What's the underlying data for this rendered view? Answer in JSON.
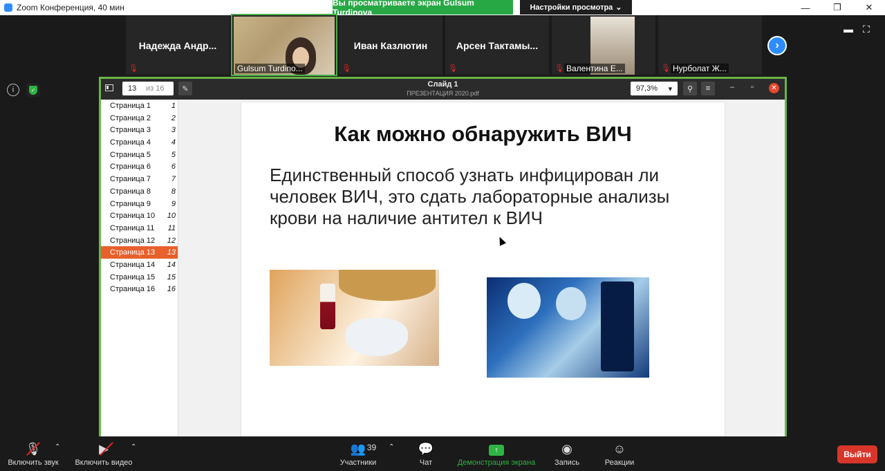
{
  "window": {
    "title": "Zoom Конференция, 40 мин",
    "share_banner": "Вы просматриваете экран Gulsum Turdinova",
    "view_settings": "Настройки просмотра",
    "controls": [
      "—",
      "❐",
      "✕"
    ]
  },
  "participants": [
    {
      "name": "Надежда  Андр...",
      "muted": true,
      "video": false
    },
    {
      "name": "Gulsum Turdino...",
      "muted": false,
      "video": true,
      "active": true
    },
    {
      "name": "Иван Казлютин",
      "muted": true,
      "video": false
    },
    {
      "name": "Арсен  Тактамы...",
      "muted": true,
      "video": false
    },
    {
      "name": "Валентина Е...",
      "muted": true,
      "video": true
    },
    {
      "name": "Нурболат Ж...",
      "muted": true,
      "video": false
    }
  ],
  "viewer": {
    "page_current": "13",
    "page_of": "из 16",
    "doc_title": "Слайд 1",
    "doc_subtitle": "ПРЕЗЕНТАЦИЯ 2020.pdf",
    "zoom": "97,3%"
  },
  "pages": [
    {
      "label": "Страница 1",
      "num": "1"
    },
    {
      "label": "Страница 2",
      "num": "2"
    },
    {
      "label": "Страница 3",
      "num": "3"
    },
    {
      "label": "Страница 4",
      "num": "4"
    },
    {
      "label": "Страница 5",
      "num": "5"
    },
    {
      "label": "Страница 6",
      "num": "6"
    },
    {
      "label": "Страница 7",
      "num": "7"
    },
    {
      "label": "Страница 8",
      "num": "8"
    },
    {
      "label": "Страница 9",
      "num": "9"
    },
    {
      "label": "Страница 10",
      "num": "10"
    },
    {
      "label": "Страница 11",
      "num": "11"
    },
    {
      "label": "Страница 12",
      "num": "12"
    },
    {
      "label": "Страница 13",
      "num": "13",
      "selected": true
    },
    {
      "label": "Страница 14",
      "num": "14"
    },
    {
      "label": "Страница 15",
      "num": "15"
    },
    {
      "label": "Страница 16",
      "num": "16"
    }
  ],
  "slide": {
    "title": "Как можно обнаружить ВИЧ",
    "body": "Единственный способ узнать инфицирован ли человек ВИЧ, это сдать лабораторные анализы крови на наличие антител к ВИЧ"
  },
  "toolbar": {
    "audio": "Включить звук",
    "video": "Включить видео",
    "participants": "Участники",
    "participants_count": "39",
    "chat": "Чат",
    "share": "Демонстрация экрана",
    "record": "Запись",
    "reactions": "Реакции",
    "leave": "Выйти"
  },
  "colors": {
    "share_green": "#28a745",
    "accent_blue": "#2d8cff",
    "selected_page": "#e8602c",
    "leave_red": "#d9362b"
  }
}
